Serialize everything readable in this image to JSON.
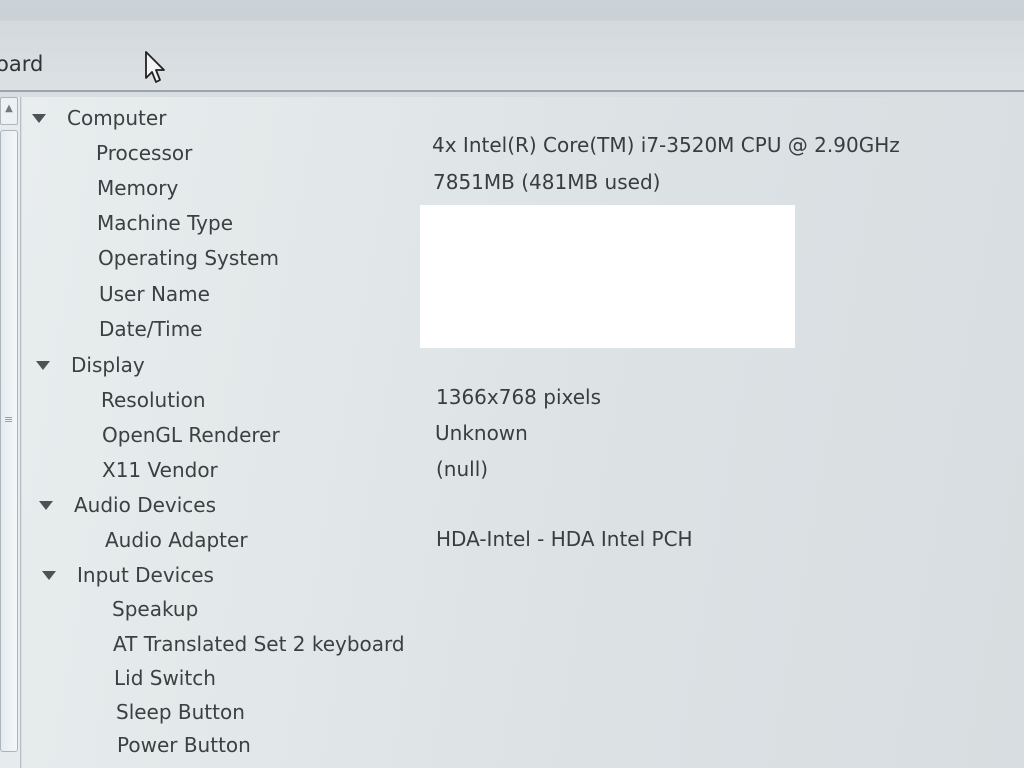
{
  "toolbar": {
    "label": "oard"
  },
  "tree": {
    "computer": {
      "label": "Computer",
      "processor": {
        "label": "Processor",
        "value": "4x Intel(R) Core(TM) i7-3520M CPU @ 2.90GHz"
      },
      "memory": {
        "label": "Memory",
        "value": "7851MB (481MB used)"
      },
      "machine_type": {
        "label": "Machine Type"
      },
      "operating_system": {
        "label": "Operating System"
      },
      "user_name": {
        "label": "User Name"
      },
      "date_time": {
        "label": "Date/Time"
      }
    },
    "display": {
      "label": "Display",
      "resolution": {
        "label": "Resolution",
        "value": "1366x768 pixels"
      },
      "opengl": {
        "label": "OpenGL Renderer",
        "value": "Unknown"
      },
      "x11": {
        "label": "X11 Vendor",
        "value": "(null)"
      }
    },
    "audio": {
      "label": "Audio Devices",
      "adapter": {
        "label": "Audio Adapter",
        "value": "HDA-Intel - HDA Intel PCH"
      }
    },
    "input": {
      "label": "Input Devices",
      "items": [
        "Speakup",
        "AT Translated Set 2 keyboard",
        "Lid Switch",
        "Sleep Button",
        "Power Button"
      ]
    }
  }
}
